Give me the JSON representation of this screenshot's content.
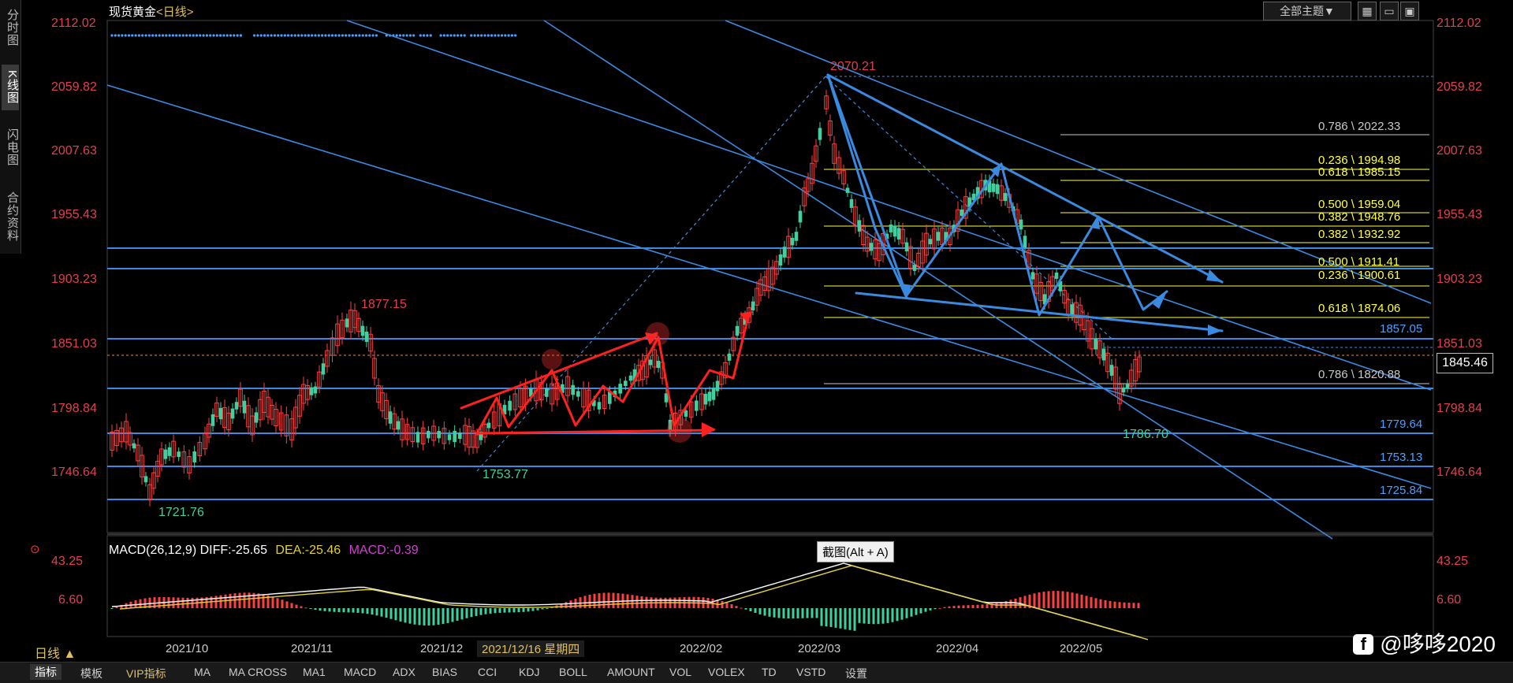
{
  "sidebar": {
    "tabs": [
      {
        "label": "分时图"
      },
      {
        "label": "K线图"
      },
      {
        "label": "闪电图"
      },
      {
        "label": "合约资料"
      }
    ]
  },
  "header": {
    "instrument": "现货黄金",
    "period": "<日线>",
    "theme_button": "全部主题▼"
  },
  "price_axis": {
    "ticks": [
      "2112.02",
      "2059.82",
      "2007.63",
      "1955.43",
      "1903.23",
      "1851.03",
      "1798.84",
      "1746.64"
    ],
    "current_price": "1845.46"
  },
  "macd_axis": {
    "ticks": [
      "43.25",
      "6.60"
    ]
  },
  "annotations": {
    "high": "2070.21",
    "peak_2021_11": "1877.15",
    "low_2021_12": "1753.77",
    "low_2021_10": "1721.76",
    "low_2022_05": "1786.70"
  },
  "fib_labels": [
    {
      "text": "0.786 \\ 2022.33",
      "color": "#c8c8c8"
    },
    {
      "text": "0.236 \\ 1994.98",
      "color": "#ffff40"
    },
    {
      "text": "0.618 \\ 1985.15",
      "color": "#ffff40"
    },
    {
      "text": "0.500 \\ 1959.04",
      "color": "#ffff40"
    },
    {
      "text": "0.382 \\ 1948.76",
      "color": "#ffff40"
    },
    {
      "text": "0.382 \\ 1932.92",
      "color": "#ffff40"
    },
    {
      "text": "0.500 \\ 1911.41",
      "color": "#ffff40"
    },
    {
      "text": "0.236 \\ 1900.61",
      "color": "#ffff40"
    },
    {
      "text": "0.618 \\ 1874.06",
      "color": "#ffff40"
    },
    {
      "text": "0.786 \\ 1820.88",
      "color": "#c8c8c8"
    }
  ],
  "support_labels": [
    "1857.05",
    "1779.64",
    "1753.13",
    "1725.84"
  ],
  "x_axis": {
    "labels": [
      "2021/10",
      "2021/11",
      "2021/12",
      "2022/02",
      "2022/03",
      "2022/04",
      "2022/05"
    ],
    "highlight": "2021/12/16 星期四",
    "period_selector": "日线 ▲"
  },
  "macd": {
    "title": "MACD(26,12,9)",
    "diff": "DIFF:-25.65",
    "dea": "DEA:-25.46",
    "macd": "MACD:-0.39"
  },
  "tooltip": "截图(Alt + A)",
  "bottom_tabs": [
    "指标",
    "模板",
    "VIP指标",
    "MA",
    "MA CROSS",
    "MA1",
    "MACD",
    "ADX",
    "BIAS",
    "CCI",
    "KDJ",
    "BOLL",
    "AMOUNT",
    "VOL",
    "VOLEX",
    "TD",
    "VSTD",
    "设置"
  ],
  "watermark": "@哆哆2020",
  "colors": {
    "up": "#ff4040",
    "down": "#40d0a0",
    "trend_blue": "#3a8ae0",
    "fib_yellow": "#ffff40",
    "price_label": "#e04050",
    "red_arrow": "#ff2020"
  }
}
